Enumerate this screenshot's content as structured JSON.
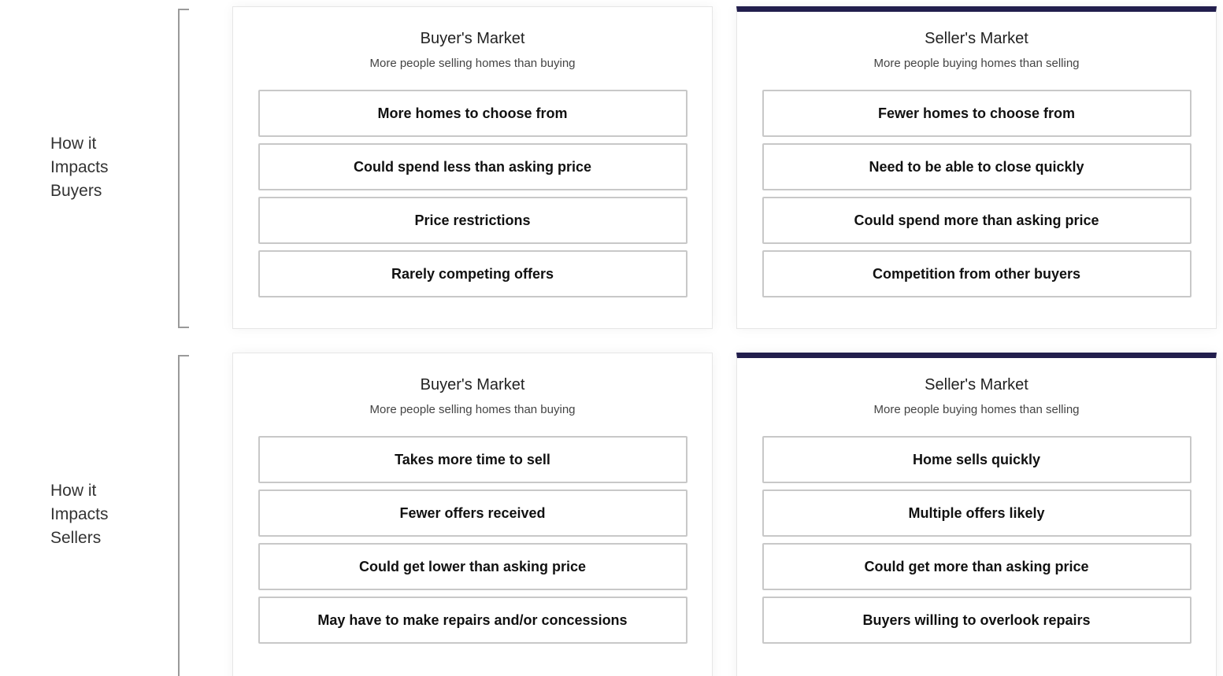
{
  "rows": {
    "buyers_label": [
      "How it",
      "Impacts",
      "Buyers"
    ],
    "sellers_label": [
      "How it",
      "Impacts",
      "Sellers"
    ]
  },
  "buyers": {
    "buyers_market": {
      "title": "Buyer's Market",
      "subtitle": "More people selling homes than buying",
      "items": [
        "More homes to choose from",
        "Could spend less than asking price",
        "Price restrictions",
        "Rarely competing offers"
      ]
    },
    "sellers_market": {
      "title": "Seller's Market",
      "subtitle": "More people buying homes than selling",
      "items": [
        "Fewer homes to choose from",
        "Need to be able to close quickly",
        "Could spend more than asking price",
        "Competition from other buyers"
      ]
    }
  },
  "sellers": {
    "buyers_market": {
      "title": "Buyer's Market",
      "subtitle": "More people selling homes than buying",
      "items": [
        "Takes more time to sell",
        "Fewer offers received",
        "Could get lower than asking price",
        "May have to make repairs and/or concessions"
      ]
    },
    "sellers_market": {
      "title": "Seller's Market",
      "subtitle": "More people buying homes than selling",
      "items": [
        "Home sells quickly",
        "Multiple offers likely",
        "Could get more than asking price",
        "Buyers willing to overlook repairs"
      ]
    }
  },
  "colors": {
    "accent": "#221e4d",
    "item_border": "#c8c8c8"
  }
}
